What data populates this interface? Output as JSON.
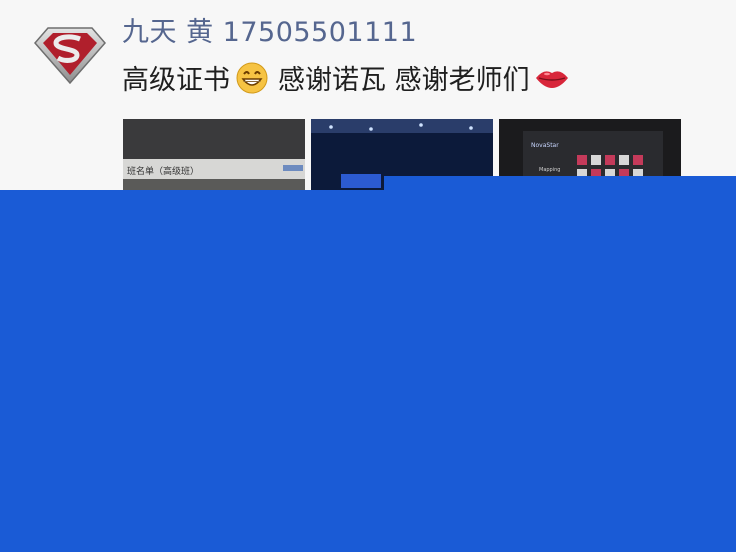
{
  "post": {
    "author": "九天 黄 17505501111",
    "text_part1": "高级证书",
    "text_part2": "感谢诺瓦 感谢老师们",
    "emojis": [
      "grinning-face-icon",
      "lips-icon"
    ],
    "photos": [
      {
        "name": "photo-class-list",
        "caption": "班名单（高级班）"
      },
      {
        "name": "photo-stage-screen"
      },
      {
        "name": "photo-novastar-presentation",
        "caption": "NovaStar",
        "subcaption": "Mapping"
      }
    ]
  },
  "colors": {
    "author": "#55668f",
    "text": "#1f1f1f",
    "overlay": "#1a5bd6"
  }
}
